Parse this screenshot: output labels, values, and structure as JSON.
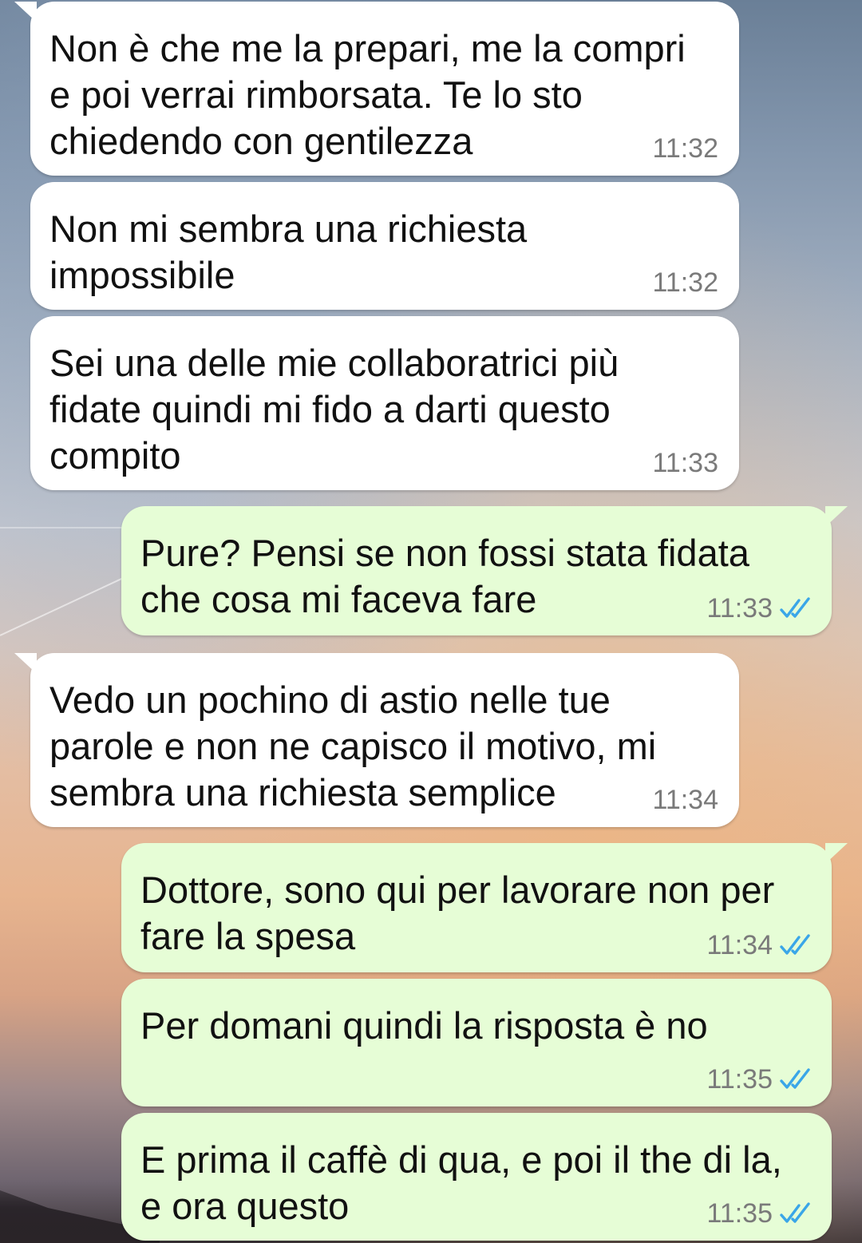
{
  "chat": {
    "messages": [
      {
        "direction": "incoming",
        "text": "Non è che me la prepari, me la compri\ne poi verrai rimborsata. Te lo sto\nchiedendo con gentilezza",
        "time": "11:32"
      },
      {
        "direction": "incoming",
        "text": "Non mi sembra una richiesta\nimpossibile",
        "time": "11:32"
      },
      {
        "direction": "incoming",
        "text": "Sei una delle mie collaboratrici più\nfidate quindi mi fido a darti questo\ncompito",
        "time": "11:33"
      },
      {
        "direction": "outgoing",
        "text": "Pure? Pensi se non fossi stata fidata\nche cosa mi faceva fare",
        "time": "11:33",
        "status_icon": "double-check-read-icon"
      },
      {
        "direction": "incoming",
        "text": "Vedo un pochino di astio nelle tue\nparole e non ne capisco il motivo, mi\nsembra una richiesta semplice",
        "time": "11:34"
      },
      {
        "direction": "outgoing",
        "text": "Dottore, sono qui per lavorare non per\nfare la spesa",
        "time": "11:34",
        "status_icon": "double-check-read-icon"
      },
      {
        "direction": "outgoing",
        "text": "Per domani quindi la risposta è no",
        "time": "11:35",
        "status_icon": "double-check-read-icon"
      },
      {
        "direction": "outgoing",
        "text": "E prima il caffè di qua, e poi il the di la,\ne ora questo",
        "time": "11:35",
        "status_icon": "double-check-read-icon"
      }
    ]
  },
  "colors": {
    "incoming_bubble": "#ffffff",
    "outgoing_bubble": "#e6fdd6",
    "read_ticks": "#3aa6e8",
    "timestamp": "#7a7a7a"
  }
}
